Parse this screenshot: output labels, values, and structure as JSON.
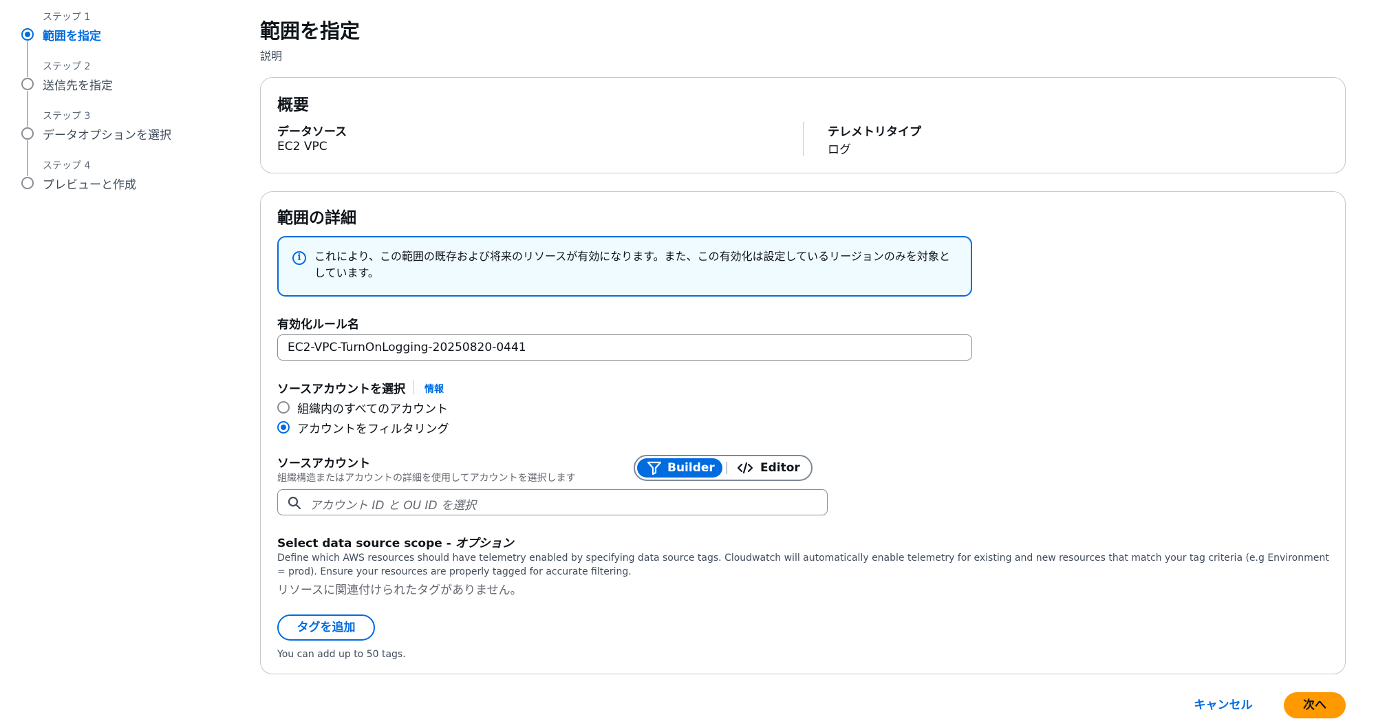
{
  "steps": [
    {
      "num": "ステップ 1",
      "title": "範囲を指定",
      "active": true
    },
    {
      "num": "ステップ 2",
      "title": "送信先を指定",
      "active": false
    },
    {
      "num": "ステップ 3",
      "title": "データオプションを選択",
      "active": false
    },
    {
      "num": "ステップ 4",
      "title": "プレビューと作成",
      "active": false
    }
  ],
  "page": {
    "title": "範囲を指定",
    "description": "説明"
  },
  "overview": {
    "title": "概要",
    "data_source_label": "データソース",
    "data_source_value": "EC2 VPC",
    "telemetry_type_label": "テレメトリタイプ",
    "telemetry_type_value": "ログ"
  },
  "scope": {
    "title": "範囲の詳細",
    "alert_text": "これにより、この範囲の既存および将来のリソースが有効になります。また、この有効化は設定しているリージョンのみを対象としています。",
    "rule_name_label": "有効化ルール名",
    "rule_name_value": "EC2-VPC-TurnOnLogging-20250820-0441",
    "source_account_select_label": "ソースアカウントを選択",
    "info_link": "情報",
    "radio_all": "組織内のすべてのアカウント",
    "radio_filter": "アカウントをフィルタリング",
    "selected_radio": "filter",
    "source_account_label": "ソースアカウント",
    "source_account_desc": "組織構造またはアカウントの詳細を使用してアカウントを選択します",
    "builder_label": "Builder",
    "editor_label": "Editor",
    "search_placeholder": "アカウント ID と OU ID を選択",
    "data_scope_title": "Select data source scope - ",
    "data_scope_optional": "オプション",
    "data_scope_desc": "Define which AWS resources should have telemetry enabled by specifying data source tags. Cloudwatch will automatically enable telemetry for existing and new resources that match your tag criteria (e.g Environment = prod). Ensure your resources are properly tagged for accurate filtering.",
    "no_tags": "リソースに関連付けられたタグがありません。",
    "add_tag_button": "タグを追加",
    "tag_hint": "You can add up to 50 tags."
  },
  "footer": {
    "cancel": "キャンセル",
    "next": "次へ"
  },
  "colors": {
    "accent": "#006ce0",
    "primary_button": "#ff9900",
    "alert_bg": "#f0fbff"
  }
}
